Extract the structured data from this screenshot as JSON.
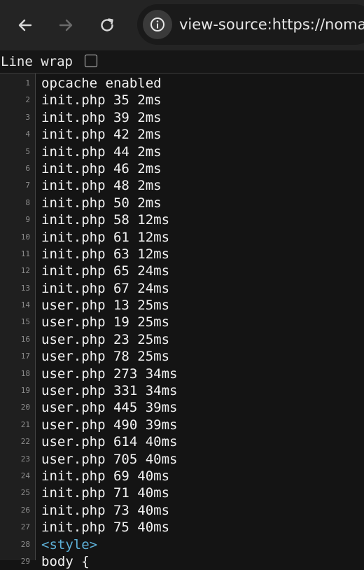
{
  "browser": {
    "url": "view-source:https://noma",
    "back_icon": "back-arrow-icon",
    "forward_icon": "forward-arrow-icon",
    "reload_icon": "reload-icon",
    "info_icon": "info-icon"
  },
  "line_wrap": {
    "label": "Line wrap",
    "checked": false
  },
  "colors": {
    "tag": "#5db0d7",
    "text": "#f2f2f2",
    "line_number": "#8c8c8c"
  },
  "lines": [
    {
      "n": "1",
      "text": "opcache enabled"
    },
    {
      "n": "2",
      "text": "init.php 35 2ms"
    },
    {
      "n": "3",
      "text": "init.php 39 2ms"
    },
    {
      "n": "4",
      "text": "init.php 42 2ms"
    },
    {
      "n": "5",
      "text": "init.php 44 2ms"
    },
    {
      "n": "6",
      "text": "init.php 46 2ms"
    },
    {
      "n": "7",
      "text": "init.php 48 2ms"
    },
    {
      "n": "8",
      "text": "init.php 50 2ms"
    },
    {
      "n": "9",
      "text": "init.php 58 12ms"
    },
    {
      "n": "10",
      "text": "init.php 61 12ms"
    },
    {
      "n": "11",
      "text": "init.php 63 12ms"
    },
    {
      "n": "12",
      "text": "init.php 65 24ms"
    },
    {
      "n": "13",
      "text": "init.php 67 24ms"
    },
    {
      "n": "14",
      "text": "user.php 13 25ms"
    },
    {
      "n": "15",
      "text": "user.php 19 25ms"
    },
    {
      "n": "16",
      "text": "user.php 23 25ms"
    },
    {
      "n": "17",
      "text": "user.php 78 25ms"
    },
    {
      "n": "18",
      "text": "user.php 273 34ms"
    },
    {
      "n": "19",
      "text": "user.php 331 34ms"
    },
    {
      "n": "20",
      "text": "user.php 445 39ms"
    },
    {
      "n": "21",
      "text": "user.php 490 39ms"
    },
    {
      "n": "22",
      "text": "user.php 614 40ms"
    },
    {
      "n": "23",
      "text": "user.php 705 40ms"
    },
    {
      "n": "24",
      "text": "init.php 69 40ms"
    },
    {
      "n": "25",
      "text": "init.php 71 40ms"
    },
    {
      "n": "26",
      "text": "init.php 73 40ms"
    },
    {
      "n": "27",
      "text": "init.php 75 40ms"
    },
    {
      "n": "28",
      "text": "<style>"
    },
    {
      "n": "29",
      "text": "    body {"
    }
  ]
}
